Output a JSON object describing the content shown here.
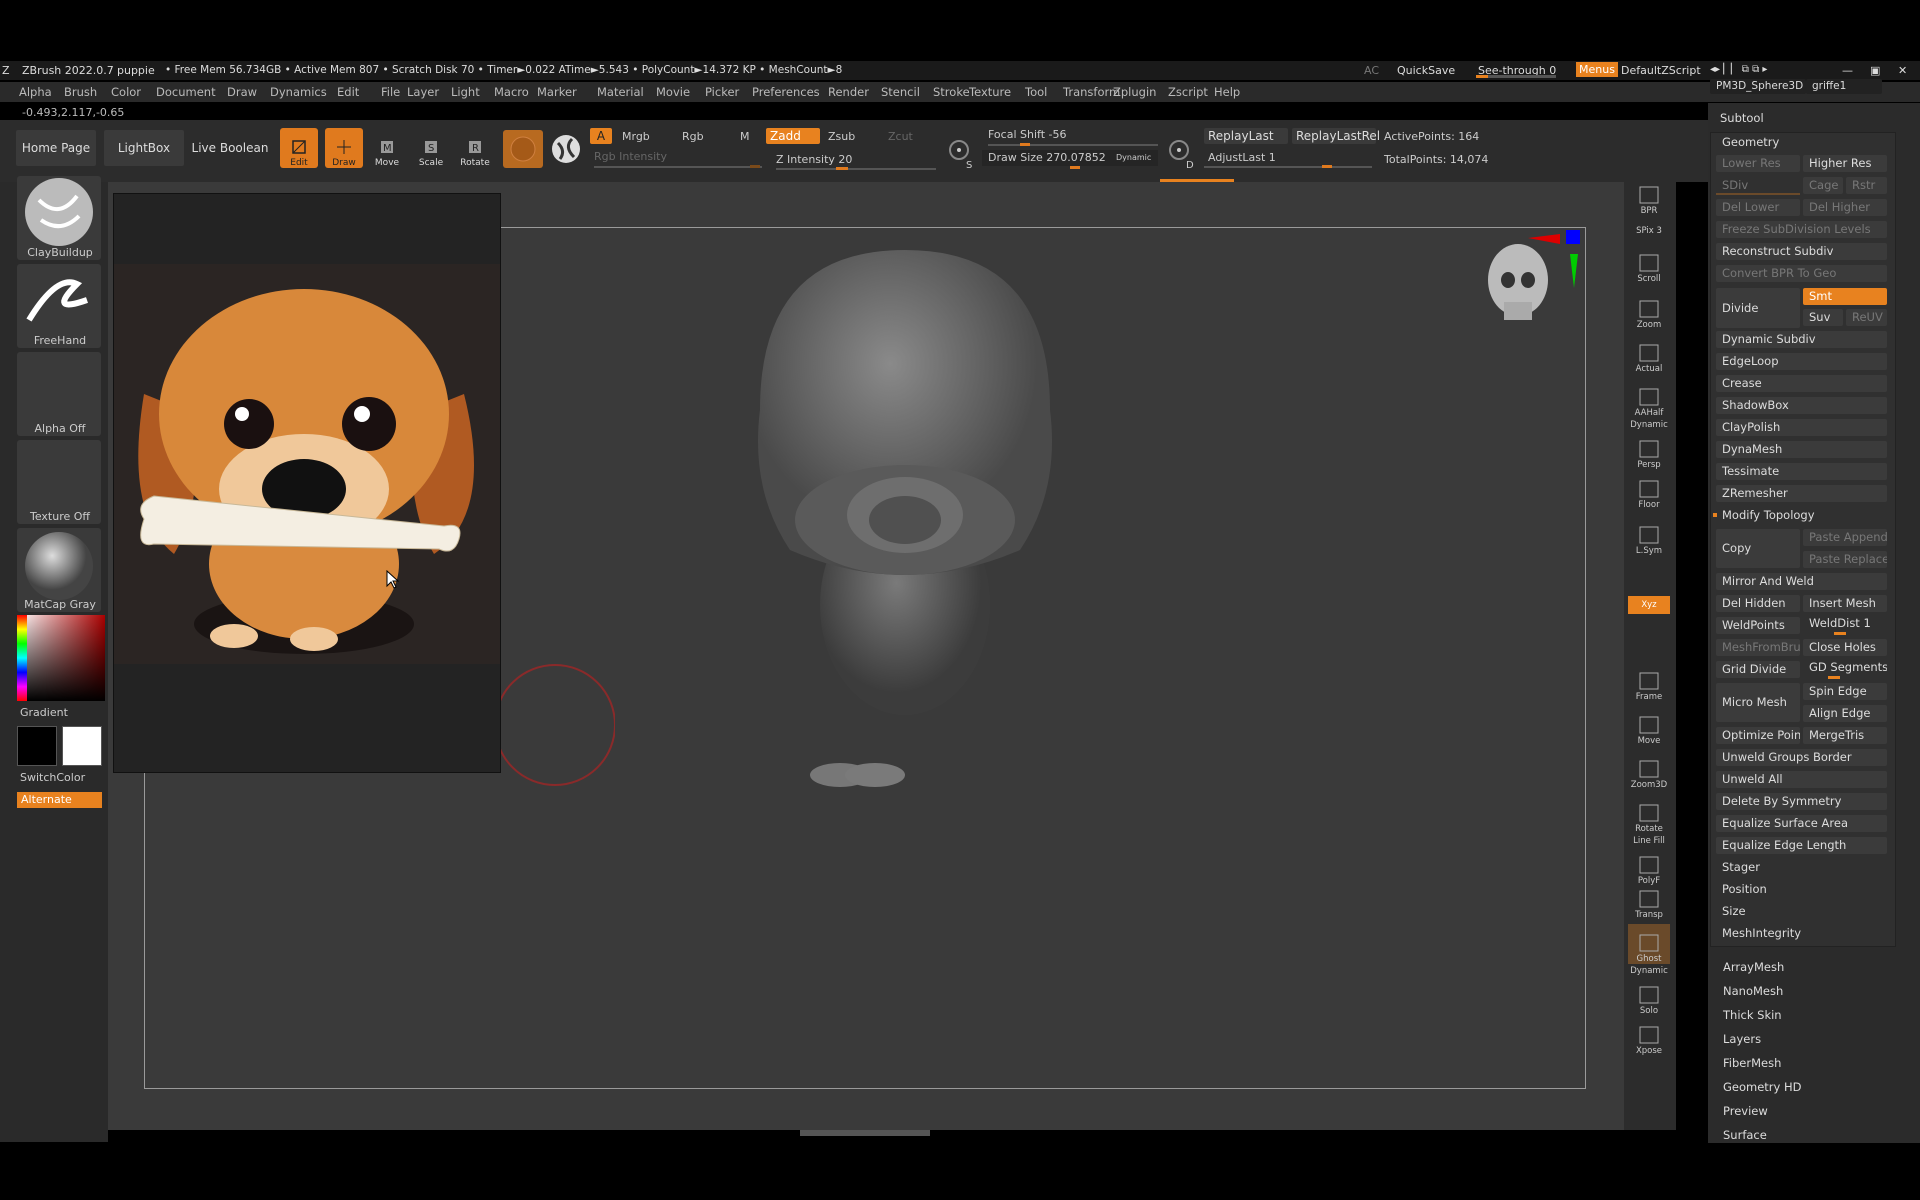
{
  "titlebar": {
    "app": "ZBrush 2022.0.7",
    "doc": "puppie",
    "stats": "• Free Mem 56.734GB • Active Mem 807 • Scratch Disk 70 • Timer►0.022 ATime►5.543 • PolyCount►14.372 KP  • MeshCount►8",
    "ac": "AC",
    "quicksave": "QuickSave",
    "seethrough": "See-through  0",
    "menus": "Menus",
    "script": "DefaultZScript"
  },
  "menu": [
    "Alpha",
    "Brush",
    "Color",
    "Document",
    "Draw",
    "Dynamics",
    "Edit",
    "File",
    "Layer",
    "Light",
    "Macro",
    "Marker",
    "Material",
    "Movie",
    "Picker",
    "Preferences",
    "Render",
    "Stencil",
    "Stroke",
    "Texture",
    "Tool",
    "Transform",
    "Zplugin",
    "Zscript",
    "Help"
  ],
  "coords": "-0.493,2.117,-0.65",
  "shelf": {
    "home": "Home Page",
    "lightbox": "LightBox",
    "liveboolean": "Live Boolean",
    "tools": [
      "Edit",
      "Draw",
      "Move",
      "Scale",
      "Rotate"
    ],
    "a": "A",
    "mrgb": "Mrgb",
    "rgb": "Rgb",
    "m": "M",
    "zadd": "Zadd",
    "zsub": "Zsub",
    "zcut": "Zcut",
    "rgb_intensity": "Rgb Intensity",
    "z_intensity": "Z Intensity 20",
    "focal_shift": "Focal Shift -56",
    "draw_size": "Draw Size 270.07852",
    "dynamic": "Dynamic",
    "replaylast": "ReplayLast",
    "replaylastrel": "ReplayLastRel",
    "adjustlast": "AdjustLast 1",
    "activepoints": "ActivePoints: 164",
    "totalpoints": "TotalPoints: 14,074",
    "s": "S",
    "d": "D"
  },
  "left": {
    "brush": "ClayBuildup",
    "stroke": "FreeHand",
    "alpha": "Alpha Off",
    "texture": "Texture Off",
    "material": "MatCap Gray",
    "gradient": "Gradient",
    "switchcolor": "SwitchColor",
    "alternate": "Alternate"
  },
  "rightbar": [
    "BPR",
    "SPix 3",
    "Scroll",
    "Zoom",
    "Actual",
    "AAHalf",
    "Dynamic",
    "Persp",
    "Floor",
    "L.Sym",
    "Xyz",
    "Frame",
    "Move",
    "Zoom3D",
    "Rotate",
    "Line Fill",
    "PolyF",
    "Transp",
    "Ghost",
    "Dynamic",
    "Solo",
    "Xpose"
  ],
  "toolpanel": {
    "top_left": "PM3D_Sphere3D",
    "top_right": "griffe1",
    "subtool": "Subtool",
    "geometry": "Geometry",
    "lower_res": "Lower Res",
    "higher_res": "Higher Res",
    "sdiv": "SDiv",
    "cage": "Cage",
    "rstr": "Rstr",
    "del_lower": "Del Lower",
    "del_higher": "Del Higher",
    "freeze": "Freeze SubDivision Levels",
    "reconstruct": "Reconstruct Subdiv",
    "convert_bpr": "Convert BPR To Geo",
    "divide": "Divide",
    "smt": "Smt",
    "suv": "Suv",
    "reuv": "ReUV",
    "items1": [
      "Dynamic Subdiv",
      "EdgeLoop",
      "Crease",
      "ShadowBox",
      "ClayPolish",
      "DynaMesh",
      "Tessimate",
      "ZRemesher"
    ],
    "modify_topology": "Modify Topology",
    "copy": "Copy",
    "paste_append": "Paste Append",
    "paste_replace": "Paste Replace",
    "mirror_weld": "Mirror And Weld",
    "del_hidden": "Del Hidden",
    "insert_mesh": "Insert Mesh",
    "weldpoints": "WeldPoints",
    "welddist": "WeldDist 1",
    "meshfrombrush": "MeshFromBrush",
    "close_holes": "Close Holes",
    "grid_divide": "Grid Divide",
    "gd_segments": "GD Segments",
    "micro_mesh": "Micro Mesh",
    "spin_edge": "Spin Edge",
    "align_edge": "Align Edge",
    "optimize_points": "Optimize Points",
    "mergetris": "MergeTris",
    "items2": [
      "Unweld Groups Border",
      "Unweld All",
      "Delete By Symmetry",
      "Equalize Surface Area",
      "Equalize Edge Length"
    ],
    "items3": [
      "Stager",
      "Position",
      "Size",
      "MeshIntegrity"
    ],
    "subpanels": [
      "ArrayMesh",
      "NanoMesh",
      "Thick Skin",
      "Layers",
      "FiberMesh",
      "Geometry HD",
      "Preview",
      "Surface"
    ]
  },
  "colors": {
    "accent": "#e8821f",
    "panel": "#2b2b2b",
    "viewport": "#3a3a3a"
  }
}
